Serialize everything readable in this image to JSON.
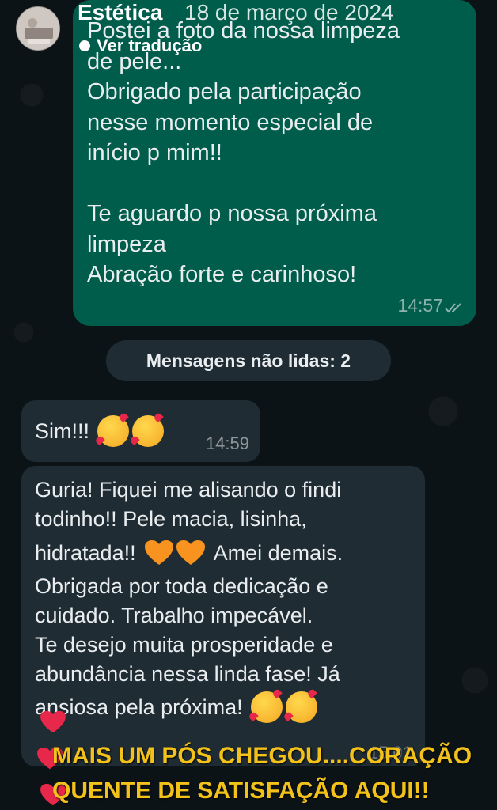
{
  "header": {
    "name": "Estética",
    "date": "18 de março de 2024",
    "translate_label": "Ver tradução"
  },
  "outgoing": {
    "lines": [
      "Postei a foto da nossa limpeza",
      "de pele...",
      "Obrigado pela participação",
      "nesse momento especial de",
      "início p mim!!",
      "",
      "Te aguardo p nossa próxima",
      "limpeza",
      "Abração forte e carinhoso!"
    ],
    "time": "14:57"
  },
  "unread_divider": "Mensagens não lidas: 2",
  "incoming": [
    {
      "text": "Sim!!!",
      "emojis": [
        "smiling-face-with-hearts",
        "smiling-face-with-hearts"
      ],
      "time": "14:59"
    },
    {
      "lines": [
        "Guria! Fiquei me alisando o findi",
        "todinho!! Pele macia, lisinha,",
        "hidratada!!",
        "Amei demais.",
        "Obrigada por toda dedicação e",
        "cuidado. Trabalho impecável.",
        "Te desejo muita prosperidade e",
        "abundância nessa linda fase! Já",
        "ansiosa pela próxima!"
      ],
      "emojis_line3": [
        "orange-heart",
        "orange-heart"
      ],
      "emojis_last": [
        "face-blowing-kiss",
        "face-blowing-kiss"
      ],
      "time": "15:01"
    }
  ],
  "caption": {
    "line1": "MAIS UM PÓS CHEGOU....CORAÇÃO",
    "line2": "QUENTE DE SATISFAÇÃO AQUI!!"
  },
  "colors": {
    "outgoing_bubble": "#005c4b",
    "incoming_bubble": "#202c33",
    "caption": "#f2c21b",
    "heart_red": "#e8284a",
    "heart_orange": "#f7931e"
  }
}
